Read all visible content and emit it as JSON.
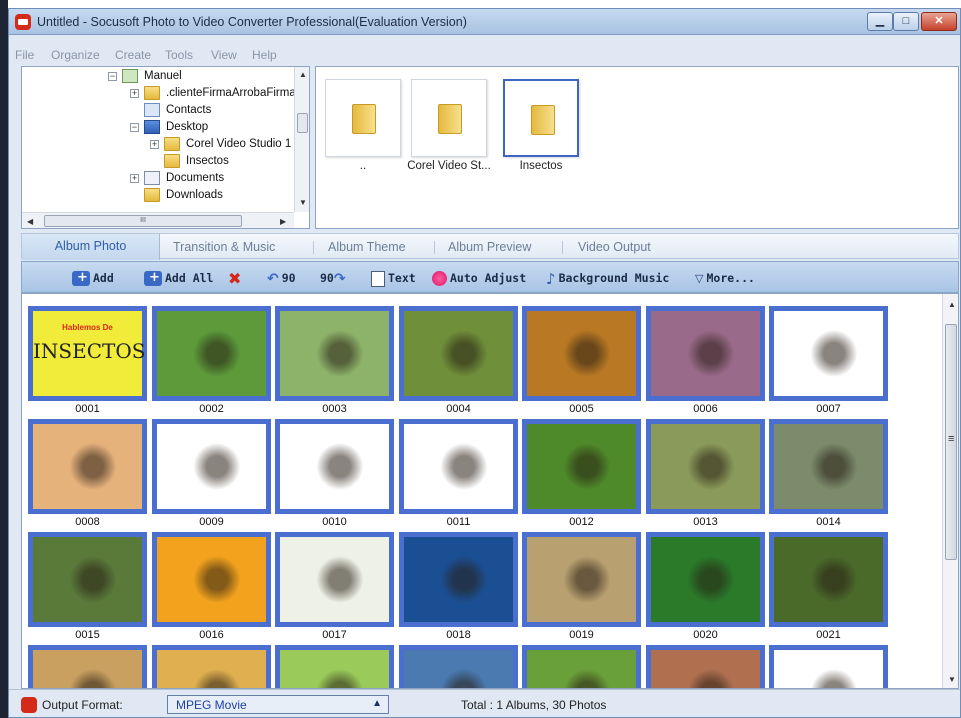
{
  "window": {
    "title": "Untitled - Socusoft Photo to Video Converter Professional(Evaluation Version)",
    "controls": {
      "minimize": "▁",
      "maximize": "□",
      "close": "✕"
    }
  },
  "menu": [
    "File",
    "Organize",
    "Create",
    "Tools",
    "View",
    "Help"
  ],
  "folder_tree": {
    "nodes": [
      {
        "label": "Manuel",
        "icon": "user-folder-icon"
      },
      {
        "label": ".clienteFirmaArrobaFirma",
        "icon": "folder-icon"
      },
      {
        "label": "Contacts",
        "icon": "contacts-icon"
      },
      {
        "label": "Desktop",
        "icon": "desktop-icon"
      },
      {
        "label": "Corel Video Studio 1",
        "icon": "folder-icon"
      },
      {
        "label": "Insectos",
        "icon": "folder-icon"
      },
      {
        "label": "Documents",
        "icon": "documents-icon"
      },
      {
        "label": "Downloads",
        "icon": "folder-icon"
      }
    ],
    "hscroll_grip": "III"
  },
  "folder_tiles": [
    {
      "caption": "..",
      "selected": false
    },
    {
      "caption": "Corel Video St...",
      "selected": false
    },
    {
      "caption": "Insectos",
      "selected": true
    }
  ],
  "tabs": [
    "Album Photo",
    "Transition & Music",
    "Album Theme",
    "Album Preview",
    "Video Output"
  ],
  "active_tab": "Album Photo",
  "toolbar": {
    "add": "Add",
    "add_all": "Add All",
    "rotate_left": "90",
    "rotate_right": "90",
    "text": "Text",
    "auto_adjust": "Auto Adjust",
    "background_music": "Background Music",
    "more": "More..."
  },
  "photos": {
    "first_thumb_text": {
      "line1": "Hablemos De",
      "line2": "INSECTOS"
    },
    "captions": [
      "0001",
      "0002",
      "0003",
      "0004",
      "0005",
      "0006",
      "0007",
      "0008",
      "0009",
      "0010",
      "0011",
      "0012",
      "0013",
      "0014",
      "0015",
      "0016",
      "0017",
      "0018",
      "0019",
      "0020",
      "0021"
    ],
    "partial_row_count": 7,
    "palettes": [
      "#f1ec3a",
      "#5c9a3a",
      "#8db36a",
      "#6f8f3a",
      "#b97924",
      "#9a6a8a",
      "#ffffff",
      "#e6b27c",
      "#ffffff",
      "#ffffff",
      "#ffffff",
      "#4f8a2a",
      "#8a9a5a",
      "#7b8b6b",
      "#5a7a3a",
      "#f2a21d",
      "#eef2e6",
      "#1b4f93",
      "#b8a070",
      "#2a7a2a",
      "#4a6a2a",
      "#c9a060",
      "#e0b050",
      "#9acb5a",
      "#4a7ab0",
      "#6aa03a",
      "#b07050",
      "#ffffff"
    ]
  },
  "status": {
    "output_label": "Output Format:",
    "format": "MPEG Movie",
    "total": "Total : 1 Albums, 30 Photos"
  },
  "colors": {
    "accent_blue": "#4a6fd0",
    "toolbar_bg": "#b8d0ec",
    "brand_red": "#d32a1a"
  }
}
